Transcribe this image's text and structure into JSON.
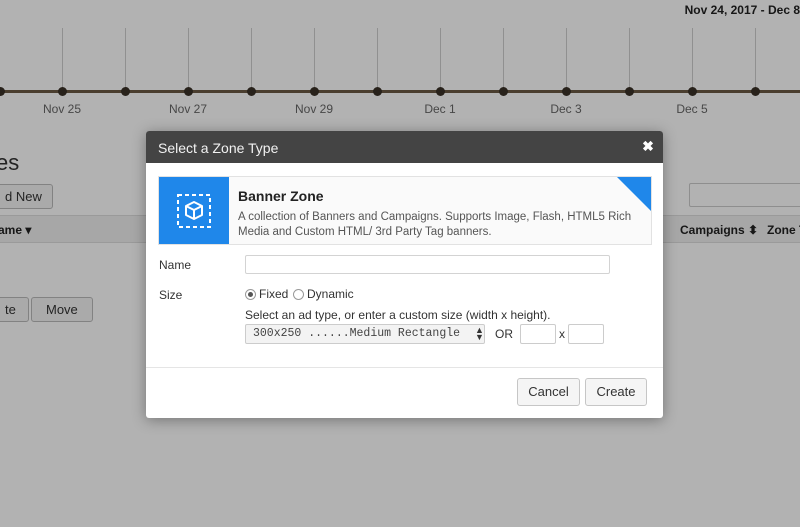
{
  "background": {
    "date_range": "Nov 24, 2017 - Dec 8",
    "timeline_ticks": [
      "Nov 25",
      "Nov 27",
      "Nov 29",
      "Dec 1",
      "Dec 3",
      "Dec 5"
    ],
    "page_heading": "es",
    "add_new_label": "d New",
    "table_headers": {
      "name": "ame",
      "campaigns": "Campaigns",
      "zone_type": "Zone T"
    },
    "bottom_buttons": {
      "left_label": "te",
      "move_label": "Move"
    }
  },
  "modal": {
    "title": "Select a Zone Type",
    "close_symbol": "✖",
    "zone_card": {
      "icon": "cube-icon",
      "title": "Banner Zone",
      "description": "A collection of Banners and Campaigns. Supports Image, Flash, HTML5 Rich Media and Custom HTML/ 3rd Party Tag banners.",
      "accent_color": "#1f87ea"
    },
    "form": {
      "name_label": "Name",
      "name_value": "",
      "size_label": "Size",
      "size_options": [
        "Fixed",
        "Dynamic"
      ],
      "size_selected": "Fixed",
      "hint": "Select an ad type, or enter a custom size (width x height).",
      "ad_type_selected": "300x250 ......Medium Rectangle",
      "or_label": "OR",
      "x_label": "x",
      "width_value": "",
      "height_value": ""
    },
    "buttons": {
      "cancel": "Cancel",
      "create": "Create"
    }
  }
}
